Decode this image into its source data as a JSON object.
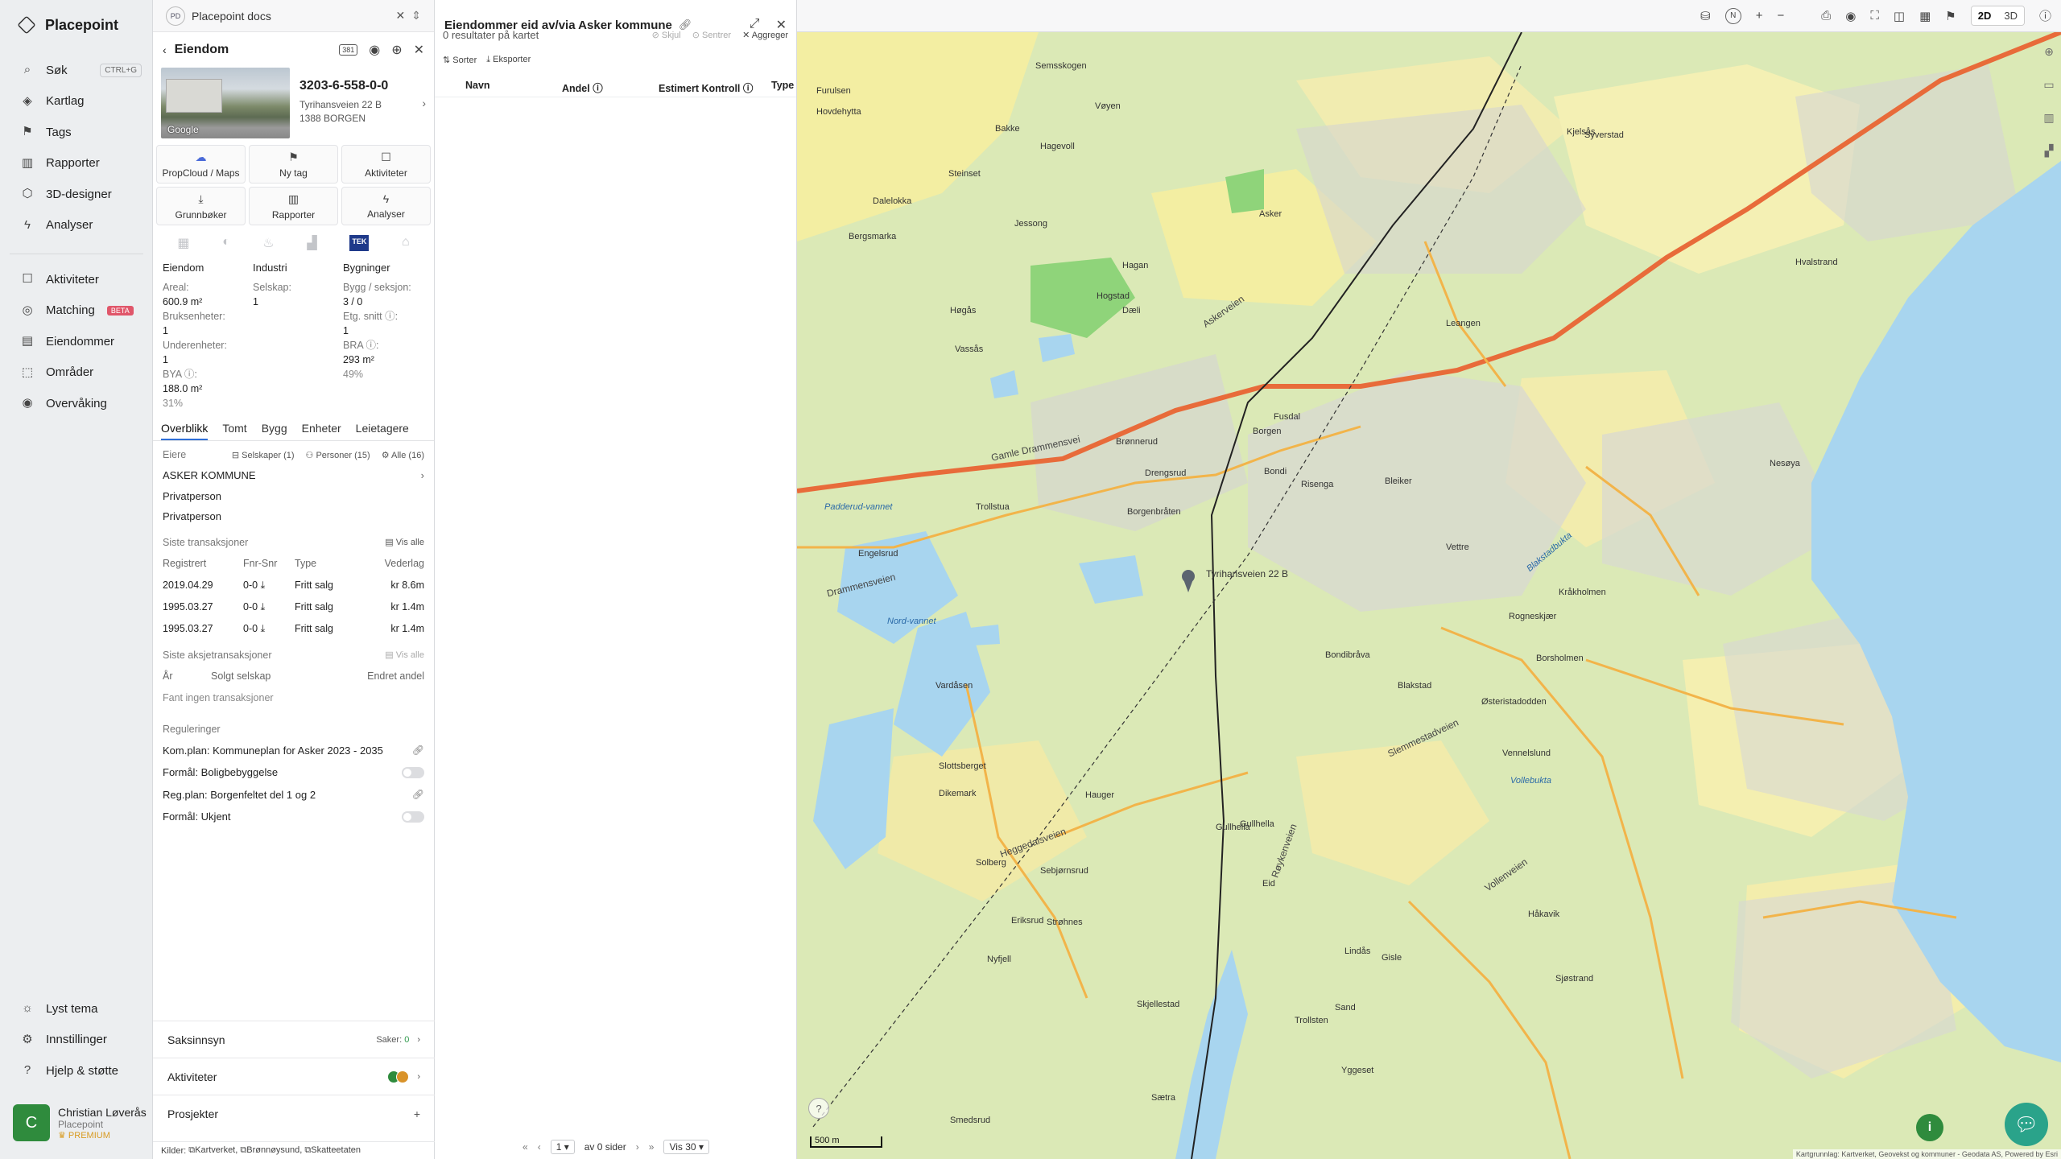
{
  "nav": {
    "brand": "Placepoint",
    "items_top": [
      {
        "label": "Søk",
        "icon": "search-icon",
        "shortcut": "CTRL+G"
      },
      {
        "label": "Kartlag",
        "icon": "layers-icon"
      },
      {
        "label": "Tags",
        "icon": "bookmark-icon"
      },
      {
        "label": "Rapporter",
        "icon": "chart-icon"
      },
      {
        "label": "3D-designer",
        "icon": "cube-icon"
      },
      {
        "label": "Analyser",
        "icon": "bolt-icon"
      }
    ],
    "items_mid": [
      {
        "label": "Aktiviteter",
        "icon": "chat-icon"
      },
      {
        "label": "Matching",
        "icon": "target-icon",
        "badge": "BETA"
      },
      {
        "label": "Eiendommer",
        "icon": "building-icon"
      },
      {
        "label": "Områder",
        "icon": "area-icon"
      },
      {
        "label": "Overvåking",
        "icon": "eye-icon"
      }
    ],
    "items_bottom": [
      {
        "label": "Lyst tema",
        "icon": "sun-icon"
      },
      {
        "label": "Innstillinger",
        "icon": "gear-icon"
      },
      {
        "label": "Hjelp & støtte",
        "icon": "help-icon"
      }
    ],
    "user": {
      "initial": "C",
      "name": "Christian Løverås",
      "org": "Placepoint",
      "plan": "PREMIUM"
    }
  },
  "workspace": {
    "badge": "PD",
    "name": "Placepoint docs"
  },
  "property": {
    "header": "Eiendom",
    "badge_381": "381",
    "photo_label": "Google",
    "id": "3203-6-558-0-0",
    "street": "Tyrihansveien 22 B",
    "postal": "1388 BORGEN",
    "actions": [
      {
        "label": "PropCloud / Maps",
        "icon": "cloud-icon"
      },
      {
        "label": "Ny tag",
        "icon": "bookmark-icon"
      },
      {
        "label": "Aktiviteter",
        "icon": "chat-icon"
      },
      {
        "label": "Grunnbøker",
        "icon": "download-icon"
      },
      {
        "label": "Rapporter",
        "icon": "chart-icon"
      },
      {
        "label": "Analyser",
        "icon": "bolt-icon"
      }
    ],
    "tek_label": "TEK",
    "stats": {
      "col1_h": "Eiendom",
      "areal_l": "Areal:",
      "areal_v": "600.9 m²",
      "bruks_l": "Bruksenheter:",
      "bruks_v": "1",
      "under_l": "Underenheter:",
      "under_v": "1",
      "bya_l": "BYA ⓘ:",
      "bya_v": "188.0 m²",
      "bya_p": "31%",
      "col2_h": "Industri",
      "selskap_l": "Selskap:",
      "selskap_v": "1",
      "col3_h": "Bygninger",
      "bygg_l": "Bygg / seksjon:",
      "bygg_v": "3 / 0",
      "etg_l": "Etg. snitt ⓘ:",
      "etg_v": "1",
      "bra_l": "BRA ⓘ:",
      "bra_v": "293 m²",
      "bra_p": "49%"
    },
    "tabs": [
      "Overblikk",
      "Tomt",
      "Bygg",
      "Enheter",
      "Leietagere"
    ],
    "owners": {
      "label": "Eiere",
      "companies": "Selskaper (1)",
      "persons": "Personer (15)",
      "all": "Alle (16)",
      "list": [
        "ASKER KOMMUNE",
        "Privatperson",
        "Privatperson"
      ]
    },
    "transactions": {
      "title": "Siste transaksjoner",
      "see_all": "Vis alle",
      "cols": [
        "Registrert",
        "Fnr-Snr",
        "Type",
        "Vederlag"
      ],
      "rows": [
        {
          "date": "2019.04.29",
          "fnr": "0-0",
          "type": "Fritt salg",
          "amount": "kr 8.6m"
        },
        {
          "date": "1995.03.27",
          "fnr": "0-0",
          "type": "Fritt salg",
          "amount": "kr 1.4m"
        },
        {
          "date": "1995.03.27",
          "fnr": "0-0",
          "type": "Fritt salg",
          "amount": "kr 1.4m"
        }
      ]
    },
    "share_tx": {
      "title": "Siste aksjetransaksjoner",
      "see_all": "Vis alle",
      "cols": [
        "År",
        "Solgt selskap",
        "Endret andel"
      ],
      "empty": "Fant ingen transaksjoner"
    },
    "regulations": {
      "title": "Reguleringer",
      "items": [
        {
          "label": "Kom.plan: Kommuneplan for Asker 2023 - 2035",
          "kind": "link"
        },
        {
          "label": "Formål: Boligbebyggelse",
          "kind": "toggle"
        },
        {
          "label": "Reg.plan: Borgenfeltet del 1 og 2",
          "kind": "link"
        },
        {
          "label": "Formål: Ukjent",
          "kind": "toggle"
        }
      ]
    },
    "saksinnsyn": {
      "label": "Saksinnsyn",
      "count_label": "Saker:",
      "count": "0"
    },
    "aktiviteter": {
      "label": "Aktiviteter"
    },
    "prosjekter": {
      "label": "Prosjekter"
    },
    "sources": {
      "label": "Kilder:",
      "items": [
        "Kartverket",
        "Brønnøysund",
        "Skatteetaten"
      ]
    }
  },
  "results": {
    "title": "Eiendommer eid av/via Asker kommune",
    "summary": "0 resultater på kartet",
    "hide": "Skjul",
    "center": "Sentrer",
    "aggregate": "Aggreger",
    "sort": "Sorter",
    "export": "Eksporter",
    "columns": [
      "Navn",
      "Andel ⓘ",
      "Estimert Kontroll ⓘ",
      "Type"
    ],
    "pager": {
      "page": "1",
      "of": "av 0 sider",
      "per_page": "Vis 30"
    }
  },
  "map": {
    "mode_2d": "2D",
    "mode_3d": "3D",
    "scale": "500 m",
    "attribution": "Kartgrunnlag: Kartverket, Geovekst og kommuner - Geodata AS, Powered by Esri",
    "pin_label": "Tyrihansveien 22 B",
    "labels": [
      {
        "t": "Semsskogen"
      },
      {
        "t": "Furulsen"
      },
      {
        "t": "Hovdehytta"
      },
      {
        "t": "Vøyen"
      },
      {
        "t": "Bakke"
      },
      {
        "t": "Hagevoll"
      },
      {
        "t": "Steinset"
      },
      {
        "t": "Dalelokka"
      },
      {
        "t": "Jessong"
      },
      {
        "t": "Bergsmarka"
      },
      {
        "t": "Hogstad"
      },
      {
        "t": "Hagan"
      },
      {
        "t": "Dæli"
      },
      {
        "t": "Høgås"
      },
      {
        "t": "Vassås"
      },
      {
        "t": "Askerveien"
      },
      {
        "t": "Asker"
      },
      {
        "t": "Gamle Drammensvei"
      },
      {
        "t": "Brønnerud"
      },
      {
        "t": "Borgen"
      },
      {
        "t": "Drengsrud"
      },
      {
        "t": "Borgenbråten"
      },
      {
        "t": "Trollstua"
      },
      {
        "t": "Drammensveien"
      },
      {
        "t": "Engelsrud"
      },
      {
        "t": "Nord-vannet"
      },
      {
        "t": "Padderud-vannet"
      },
      {
        "t": "Vardåsen"
      },
      {
        "t": "Slottsberget"
      },
      {
        "t": "Dikemark"
      },
      {
        "t": "Heggedalsveien"
      },
      {
        "t": "Solberg"
      },
      {
        "t": "Sebjørnsrud"
      },
      {
        "t": "Hauger"
      },
      {
        "t": "Eriksrud"
      },
      {
        "t": "Strøhnes"
      },
      {
        "t": "Nyfjell"
      },
      {
        "t": "Skjellestad"
      },
      {
        "t": "Sætra"
      },
      {
        "t": "Smedsrud"
      },
      {
        "t": "Gullhella"
      },
      {
        "t": "Bondibråva"
      },
      {
        "t": "Blakstad"
      },
      {
        "t": "Slemmestadveien"
      },
      {
        "t": "Røykenveien"
      },
      {
        "t": "Vollenveien"
      },
      {
        "t": "Leangen"
      },
      {
        "t": "Bleiker"
      },
      {
        "t": "Vettre"
      },
      {
        "t": "Blakstadbukta"
      },
      {
        "t": "Kråkholmen"
      },
      {
        "t": "Rogneskjær"
      },
      {
        "t": "Borsholmen"
      },
      {
        "t": "Østeristadodden"
      },
      {
        "t": "Vennelslund"
      },
      {
        "t": "Vollebukta"
      },
      {
        "t": "Håkavik"
      },
      {
        "t": "Sjøstrand"
      },
      {
        "t": "Lindås"
      },
      {
        "t": "Gisle"
      },
      {
        "t": "Sand"
      },
      {
        "t": "Trollsten"
      },
      {
        "t": "Yggeset"
      },
      {
        "t": "Eid"
      },
      {
        "t": "Hvalstrand"
      },
      {
        "t": "Syverstad"
      },
      {
        "t": "Fusdal"
      },
      {
        "t": "Bondi"
      },
      {
        "t": "Risenga"
      },
      {
        "t": "Nesøya"
      },
      {
        "t": "Gullhella"
      },
      {
        "t": "Kjelsås"
      }
    ]
  }
}
